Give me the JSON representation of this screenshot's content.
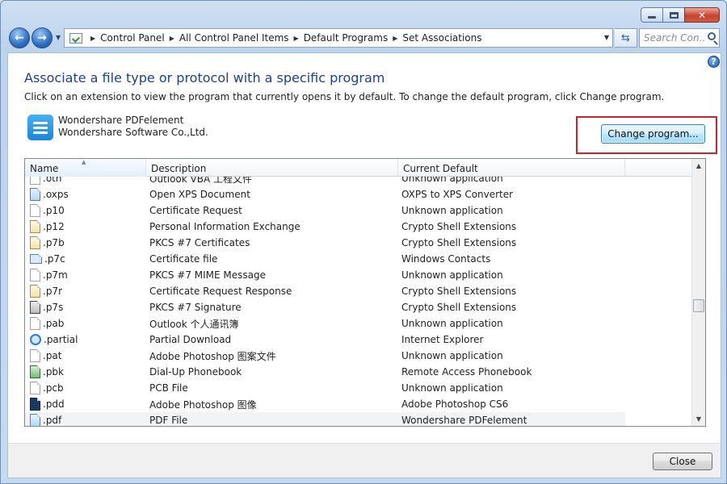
{
  "window": {
    "caption_min": "",
    "caption_max": "",
    "caption_close": "✕"
  },
  "navigation": {
    "back_glyph": "←",
    "forward_glyph": "→",
    "breadcrumbs": [
      "Control Panel",
      "All Control Panel Items",
      "Default Programs",
      "Set Associations"
    ],
    "search_placeholder": "Search Con..."
  },
  "page": {
    "help_glyph": "?",
    "heading": "Associate a file type or protocol with a specific program",
    "instruction": "Click on an extension to view the program that currently opens it by default. To change the default program, click Change program.",
    "app_name": "Wondershare PDFelement",
    "app_publisher": "Wondershare Software Co.,Ltd.",
    "change_button": "Change program..."
  },
  "list": {
    "columns": [
      "Name",
      "Description",
      "Current Default"
    ],
    "rows": [
      {
        "name": ".oth",
        "description": "Outlook VBA 工程文件",
        "default": "Unknown application",
        "icon": "generic-file-icon"
      },
      {
        "name": ".oxps",
        "description": "Open XPS Document",
        "default": "OXPS to XPS Converter",
        "icon": "xps-file-icon"
      },
      {
        "name": ".p10",
        "description": "Certificate Request",
        "default": "Unknown application",
        "icon": "generic-file-icon"
      },
      {
        "name": ".p12",
        "description": "Personal Information Exchange",
        "default": "Crypto Shell Extensions",
        "icon": "certificate-key-icon"
      },
      {
        "name": ".p7b",
        "description": "PKCS #7 Certificates",
        "default": "Crypto Shell Extensions",
        "icon": "certificate-icon"
      },
      {
        "name": ".p7c",
        "description": "Certificate file",
        "default": "Windows Contacts",
        "icon": "contact-card-icon"
      },
      {
        "name": ".p7m",
        "description": "PKCS #7 MIME Message",
        "default": "Unknown application",
        "icon": "generic-file-icon"
      },
      {
        "name": ".p7r",
        "description": "Certificate Request Response",
        "default": "Crypto Shell Extensions",
        "icon": "certificate-icon"
      },
      {
        "name": ".p7s",
        "description": "PKCS #7 Signature",
        "default": "Crypto Shell Extensions",
        "icon": "signature-file-icon"
      },
      {
        "name": ".pab",
        "description": "Outlook 个人通讯簿",
        "default": "Unknown application",
        "icon": "generic-file-icon"
      },
      {
        "name": ".partial",
        "description": "Partial Download",
        "default": "Internet Explorer",
        "icon": "internet-explorer-icon"
      },
      {
        "name": ".pat",
        "description": "Adobe Photoshop 图案文件",
        "default": "Unknown application",
        "icon": "generic-file-icon"
      },
      {
        "name": ".pbk",
        "description": "Dial-Up Phonebook",
        "default": "Remote Access Phonebook",
        "icon": "phonebook-icon"
      },
      {
        "name": ".pcb",
        "description": "PCB File",
        "default": "Unknown application",
        "icon": "generic-file-icon"
      },
      {
        "name": ".pdd",
        "description": "Adobe Photoshop 图像",
        "default": "Adobe Photoshop CS6",
        "icon": "photoshop-file-icon"
      },
      {
        "name": ".pdf",
        "description": "PDF File",
        "default": "Wondershare PDFelement",
        "icon": "pdf-file-icon"
      }
    ]
  },
  "footer": {
    "close_button": "Close"
  }
}
